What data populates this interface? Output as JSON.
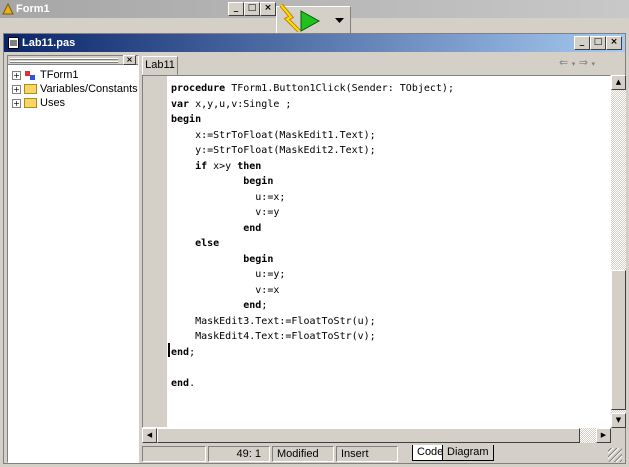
{
  "background_window": {
    "title": "Form1"
  },
  "editor": {
    "title": "Lab11.pas",
    "tab_label": "Lab11"
  },
  "explorer": {
    "items": [
      {
        "label": "TForm1"
      },
      {
        "label": "Variables/Constants"
      },
      {
        "label": "Uses"
      }
    ]
  },
  "code": {
    "lines": [
      {
        "kw": "procedure",
        "rest": " TForm1.Button1Click(Sender: TObject);"
      },
      {
        "kw": "var",
        "rest": " x,y,u,v:Single ;"
      },
      {
        "kw": "begin",
        "rest": ""
      },
      {
        "kw": "",
        "rest": "    x:=StrToFloat(MaskEdit1.Text);"
      },
      {
        "kw": "",
        "rest": "    y:=StrToFloat(MaskEdit2.Text);"
      },
      {
        "kw": "    if",
        "rest": " x>y ",
        "kw2": "then"
      },
      {
        "kw": "            begin",
        "rest": ""
      },
      {
        "kw": "",
        "rest": "              u:=x;"
      },
      {
        "kw": "",
        "rest": "              v:=y"
      },
      {
        "kw": "            end",
        "rest": ""
      },
      {
        "kw": "    else",
        "rest": ""
      },
      {
        "kw": "            begin",
        "rest": ""
      },
      {
        "kw": "",
        "rest": "              u:=y;"
      },
      {
        "kw": "",
        "rest": "              v:=x"
      },
      {
        "kw": "            end",
        "rest": ";"
      },
      {
        "kw": "",
        "rest": "    MaskEdit3.Text:=FloatToStr(u);"
      },
      {
        "kw": "",
        "rest": "    MaskEdit4.Text:=FloatToStr(v);"
      },
      {
        "kw": "end",
        "rest": ";"
      },
      {
        "kw": "",
        "rest": ""
      },
      {
        "kw": "end",
        "rest": "."
      }
    ]
  },
  "status": {
    "position": "49:  1",
    "modified": "Modified",
    "mode": "Insert",
    "tab_code": "Code",
    "tab_diagram": "Diagram"
  },
  "colors": {
    "editor_title_start": "#0a246a",
    "editor_title_end": "#a6caf0",
    "inactive_title": "#a6a6a6"
  },
  "icons": {
    "run": "run-arrow-icon",
    "dropdown": "chevron-down-icon"
  }
}
